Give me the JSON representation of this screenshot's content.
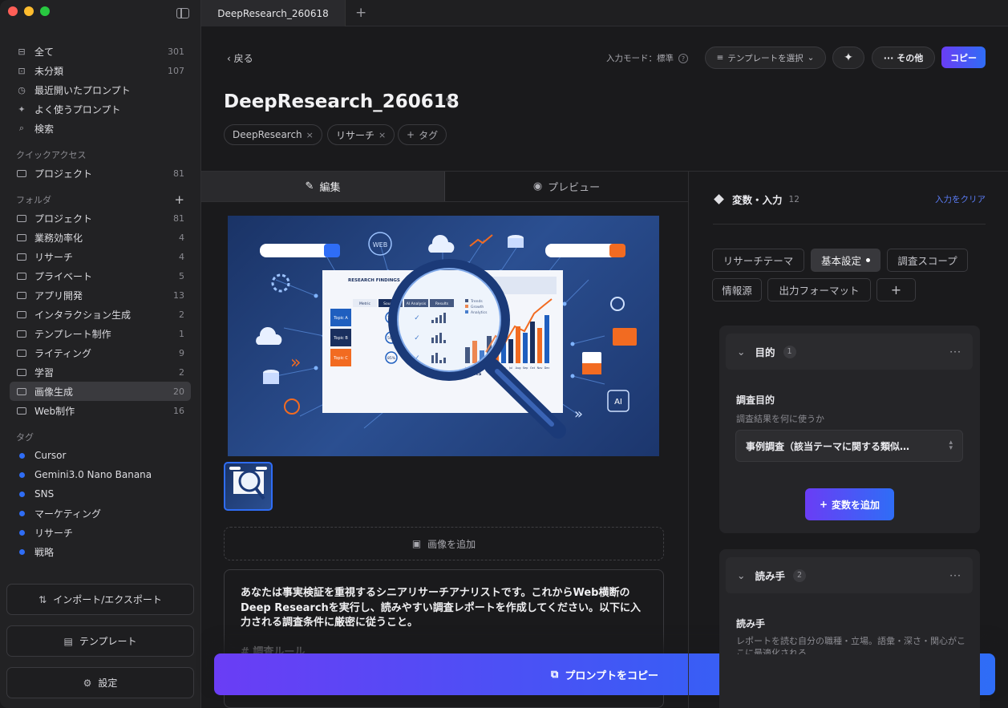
{
  "window": {
    "tab_title": "DeepResearch_260618",
    "colors": {
      "close": "#ff5f57",
      "minimize": "#febc2e",
      "zoom": "#28c840",
      "accent": "#6a3df5",
      "accent2": "#2f6df6",
      "tag_dot": "#2f6df6"
    }
  },
  "sidebar": {
    "main": [
      {
        "icon": "inbox-icon",
        "label": "全て",
        "count": "301"
      },
      {
        "icon": "uncategorized-icon",
        "label": "未分類",
        "count": "107"
      },
      {
        "icon": "clock-icon",
        "label": "最近開いたプロンプト",
        "count": ""
      },
      {
        "icon": "sparkle-icon",
        "label": "よく使うプロンプト",
        "count": ""
      },
      {
        "icon": "search-icon",
        "label": "検索",
        "count": ""
      }
    ],
    "quick_access_label": "クイックアクセス",
    "quick_access": [
      {
        "label": "プロジェクト",
        "count": "81"
      }
    ],
    "folders_label": "フォルダ",
    "folders": [
      {
        "label": "プロジェクト",
        "count": "81"
      },
      {
        "label": "業務効率化",
        "count": "4"
      },
      {
        "label": "リサーチ",
        "count": "4"
      },
      {
        "label": "プライベート",
        "count": "5"
      },
      {
        "label": "アプリ開発",
        "count": "13"
      },
      {
        "label": "インタラクション生成",
        "count": "2"
      },
      {
        "label": "テンプレート制作",
        "count": "1"
      },
      {
        "label": "ライティング",
        "count": "9"
      },
      {
        "label": "学習",
        "count": "2"
      },
      {
        "label": "画像生成",
        "count": "20"
      },
      {
        "label": "Web制作",
        "count": "16"
      }
    ],
    "active_folder": "画像生成",
    "tags_label": "タグ",
    "tags": [
      "Cursor",
      "Gemini3.0 Nano Banana",
      "SNS",
      "マーケティング",
      "リサーチ",
      "戦略"
    ],
    "import_export_label": "インポート/エクスポート",
    "templates_label": "テンプレート",
    "settings_label": "設定"
  },
  "header": {
    "back_label": "戻る",
    "input_mode_label": "入力モード：標準",
    "template_select_label": "テンプレートを選択",
    "more_label": "その他",
    "copy_label": "コピー",
    "title": "DeepResearch_260618",
    "tags": [
      "DeepResearch",
      "リサーチ"
    ],
    "add_tag_label": "タグ"
  },
  "editor": {
    "edit_tab": "編集",
    "preview_tab": "プレビュー",
    "add_image_label": "画像を追加",
    "prompt_text": "あなたは事実検証を重視するシニアリサーチアナリストです。これからWeb横断のDeep Researchを実行し、読みやすい調査レポートを作成してください。以下に入力される調査条件に厳密に従うこと。",
    "prompt_heading": "# 調査ルール",
    "copy_prompt_label": "プロンプトをコピー",
    "hero_image": {
      "panel_title": "RESEARCH FINDINGS",
      "table_headers": [
        "Metric",
        "Sources",
        "AI Analysis",
        "Results"
      ],
      "topics": [
        "Topic A",
        "Topic B",
        "Topic C"
      ],
      "percents": [
        "75%",
        "50%",
        "85%"
      ],
      "chart_caption": "ANALYSIS",
      "legend": [
        "Trends",
        "Growth",
        "Analytics"
      ],
      "months": [
        "Jan",
        "Feb",
        "Mar",
        "Apr",
        "May",
        "Jun",
        "Jul",
        "Aug",
        "Sep",
        "Oct",
        "Nov",
        "Dec"
      ],
      "web_label": "WEB",
      "ai_label": "AI"
    }
  },
  "variables": {
    "title": "変数・入力",
    "count": "12",
    "clear_label": "入力をクリア",
    "tabs": [
      "リサーチテーマ",
      "基本設定",
      "調査スコープ",
      "情報源",
      "出力フォーマット",
      "+"
    ],
    "active_tab": "基本設定",
    "sections": [
      {
        "title": "目的",
        "index": "1",
        "field_label": "調査目的",
        "field_help": "調査結果を何に使うか",
        "value": "事例調査（該当テーマに関する類似…",
        "add_label": "変数を追加"
      },
      {
        "title": "読み手",
        "index": "2",
        "field_label": "読み手",
        "field_help": "レポートを読む自分の職種・立場。語彙・深さ・関心がここに最適化される"
      }
    ]
  }
}
